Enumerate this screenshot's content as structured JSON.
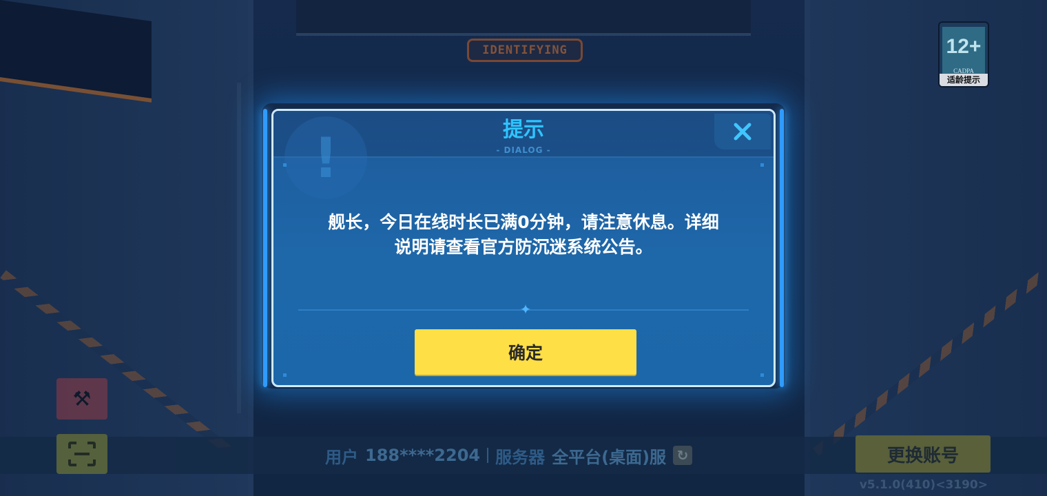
{
  "scene": {
    "door_sign": "IDENTIFYING"
  },
  "age_rating": {
    "rating": "12+",
    "org": "CADPA",
    "label": "适龄提示"
  },
  "dialog": {
    "title": "提示",
    "subtitle": "- DIALOG -",
    "message_line1": "舰长，今日在线时长已满0分钟，请注意休息。详细",
    "message_line2": "说明请查看官方防沉迷系统公告。",
    "confirm_label": "确定",
    "close_icon": "close-icon"
  },
  "account_bar": {
    "user_label": "用户",
    "user_value": "188****2204",
    "server_label": "服务器",
    "server_value": "全平台(桌面)服",
    "switch_account_label": "更换账号",
    "version": "v5.1.0(410)<3190>"
  },
  "colors": {
    "dialog_title": "#2fc4ff",
    "confirm_button": "#ffdf46",
    "dialog_border": "#cfe9ff"
  }
}
